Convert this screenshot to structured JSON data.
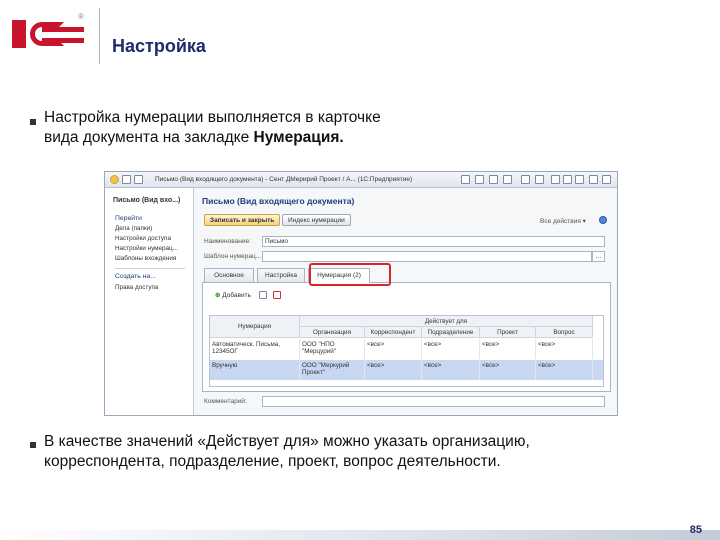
{
  "header": {
    "logo_text": "1С",
    "registered": "®",
    "title": "Настройка"
  },
  "bullets": [
    {
      "text_a": "Настройка нумерации выполняется в карточке",
      "text_b": "вида документа на закладке ",
      "bold": "Нумерация."
    },
    {
      "text_a": "В качестве значений «Действует для» можно указать организацию,",
      "text_b": "корреспондента, подразделение, проект, вопрос деятельности."
    }
  ],
  "window": {
    "title": "Письмо (Вид входящего документа) - Сент ДМеририй Проект / А... (1С:Предприятие)",
    "sidebar": {
      "heading": "Письмо (Вид вхо...)",
      "group1": "Перейти",
      "items1": [
        "Дела (папки)",
        "Настройки доступа",
        "Настройки нумерац...",
        "Шаблоны вхождения"
      ],
      "group2": "Создать на...",
      "items2": [
        "Права доступа"
      ]
    },
    "doc_title": "Письмо (Вид входящего документа)",
    "toolbar": {
      "save_close": "Записать и закрыть",
      "index": "Индекс нумерации",
      "all_actions": "Все действия ▾"
    },
    "fields": {
      "name_label": "Наименование:",
      "name_value": "Письмо",
      "template_label": "Шаблон нумерац...",
      "template_value": "",
      "comment_label": "Комментарий:"
    },
    "tabs": [
      "Основное",
      "Настройка",
      "Нумерация (2)"
    ],
    "panel": {
      "add_button": "Добавить",
      "columns": {
        "numbering": "Нумерация",
        "valid_for": "Действует для",
        "organization": "Организация",
        "correspondent": "Корреспондент",
        "department": "Подразделение",
        "project": "Проект",
        "question": "Вопрос"
      },
      "rows": [
        {
          "numbering": "Автоматическ. Письма, 12345ОГ",
          "organization": "ООО \"НПО \"Мерцурий\"",
          "correspondent": "<все>",
          "department": "<все>",
          "project": "<все>",
          "question": "<все>"
        },
        {
          "numbering": "Вручную",
          "organization": "ООО \"Меркурий Проект\"",
          "correspondent": "<все>",
          "department": "<все>",
          "project": "<все>",
          "question": "<все>"
        }
      ]
    }
  },
  "page_number": "85",
  "colors": {
    "accent_red": "#c8142d",
    "title_blue": "#1f2b6b",
    "highlight_red": "#d9262a"
  }
}
